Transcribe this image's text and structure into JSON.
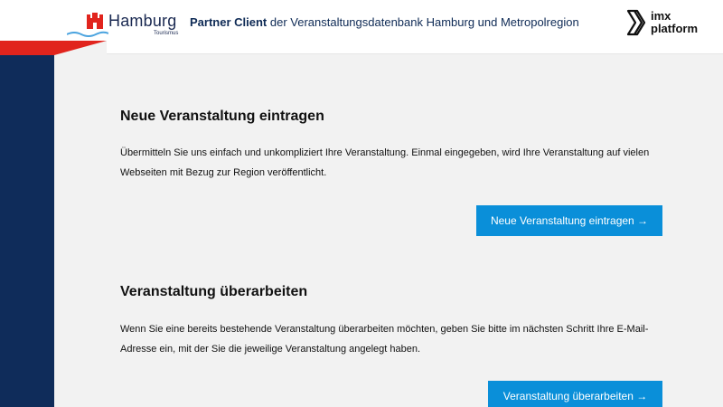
{
  "header": {
    "logo_word": "Hamburg",
    "logo_sub": "Tourismus",
    "title_strong": "Partner Client",
    "title_rest": " der Veranstaltungsdatenbank Hamburg und Metropolregion",
    "imx_line1": "imx",
    "imx_line2": "platform"
  },
  "sections": [
    {
      "heading": "Neue Veranstaltung eintragen",
      "text": "Übermitteln Sie uns einfach und unkompliziert Ihre Veranstaltung. Einmal eingegeben, wird Ihre Veranstaltung auf vielen Webseiten mit Bezug zur Region veröffentlicht.",
      "button": "Neue Veranstaltung eintragen →"
    },
    {
      "heading": "Veranstaltung überarbeiten",
      "text": "Wenn Sie eine bereits bestehende Veranstaltung überarbeiten möchten, geben Sie bitte im nächsten Schritt Ihre E-Mail-Adresse ein, mit der Sie die jeweilige Veranstaltung angelegt haben.",
      "button": "Veranstaltung überarbeiten →"
    }
  ],
  "colors": {
    "navy": "#0f2c5a",
    "red": "#e1241d",
    "button_blue": "#0a8fd9",
    "background": "#f2f2f2"
  }
}
